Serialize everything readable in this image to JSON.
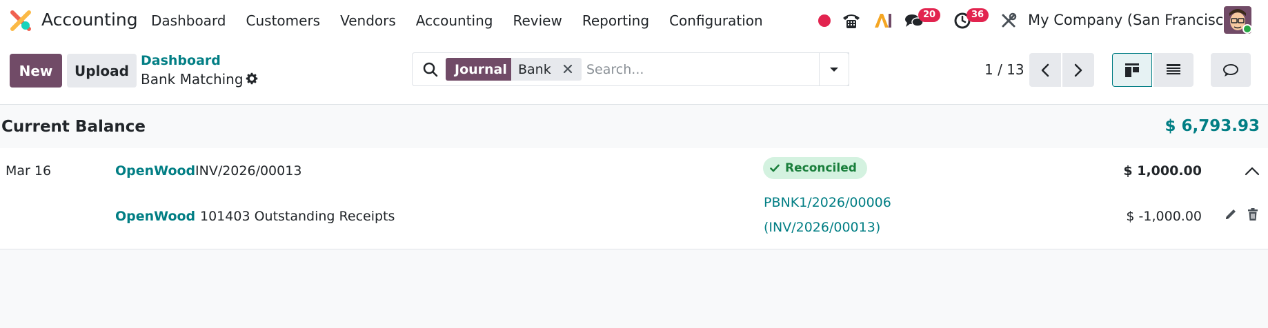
{
  "app": {
    "name": "Accounting"
  },
  "menu": [
    "Dashboard",
    "Customers",
    "Vendors",
    "Accounting",
    "Review",
    "Reporting",
    "Configuration"
  ],
  "systray": {
    "messages_count": "20",
    "activities_count": "36",
    "company": "My Company (San Francisco)",
    "record_color": "#e2244f"
  },
  "control_panel": {
    "new_label": "New",
    "upload_label": "Upload",
    "breadcrumb_parent": "Dashboard",
    "breadcrumb_current": "Bank Matching",
    "search": {
      "facet_label": "Journal",
      "facet_value": "Bank",
      "placeholder": "Search..."
    },
    "pager": "1 / 13"
  },
  "balance": {
    "label": "Current Balance",
    "amount": "$ 6,793.93"
  },
  "statement_line": {
    "date": "Mar 16",
    "partner": "OpenWood",
    "reference": "INV/2026/00013",
    "status": "Reconciled",
    "amount": "$ 1,000.00",
    "matched_line": {
      "partner": "OpenWood",
      "account": "101403 Outstanding Receipts",
      "move_ref_line1": "PBNK1/2026/00006",
      "move_ref_line2": "(INV/2026/00013)",
      "amount": "$ -1,000.00"
    }
  },
  "colors": {
    "brand": "#714b67",
    "accent": "#017e84",
    "badge": "#e2244f",
    "reconciled_bg": "#d4f2e0"
  }
}
